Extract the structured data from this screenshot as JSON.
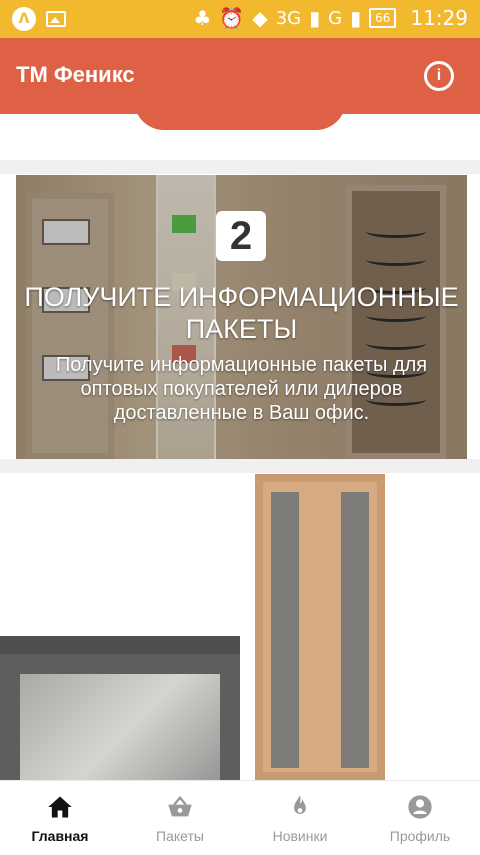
{
  "status_bar": {
    "left_badge": "Λ",
    "network_3g": "3G",
    "network_g": "G",
    "battery": "66",
    "time": "11:29",
    "icons": [
      "badge-icon",
      "image-icon",
      "tree-icon",
      "alarm-icon",
      "wifi-icon",
      "signal-icon",
      "battery-icon"
    ]
  },
  "appbar": {
    "title": "ТМ Феникс",
    "info_icon": "i"
  },
  "banner": {
    "step": "2",
    "title": "ПОЛУЧИТЕ ИНФОРМАЦИОННЫЕ ПАКЕТЫ",
    "subtitle": "Получите информационные пакеты для оптовых покупателей или дилеров доставленные в Ваш офис."
  },
  "tabs": [
    {
      "label": "Главная",
      "icon": "home-icon",
      "active": true
    },
    {
      "label": "Пакеты",
      "icon": "basket-icon",
      "active": false
    },
    {
      "label": "Новинки",
      "icon": "flame-icon",
      "active": false
    },
    {
      "label": "Профиль",
      "icon": "profile-icon",
      "active": false
    }
  ],
  "colors": {
    "status_bar": "#f2b92e",
    "appbar": "#de6146",
    "tab_active": "#111111",
    "tab_inactive": "#999999"
  }
}
